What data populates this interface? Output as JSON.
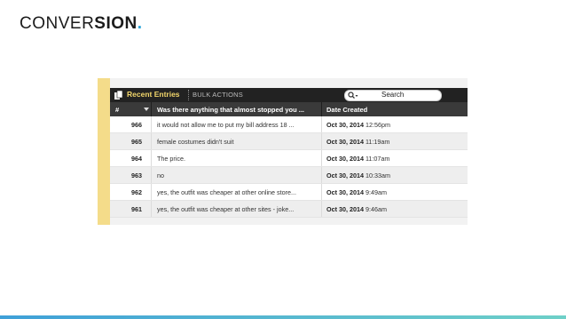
{
  "brand": {
    "part1": "CONVER",
    "part2": "SION",
    "dot": "."
  },
  "panel": {
    "title": "Recent Entries",
    "bulk_actions": "BULK ACTIONS",
    "search_label": "Search",
    "columns": {
      "num": "#",
      "question": "Was there anything that almost stopped you ...",
      "date": "Date Created"
    },
    "rows": [
      {
        "num": "966",
        "answer": "it would not allow me to put my bill address 18 ...",
        "date": "Oct 30, 2014",
        "time": "12:56pm"
      },
      {
        "num": "965",
        "answer": "female costumes didn't suit",
        "date": "Oct 30, 2014",
        "time": "11:19am"
      },
      {
        "num": "964",
        "answer": "The price.",
        "date": "Oct 30, 2014",
        "time": "11:07am"
      },
      {
        "num": "963",
        "answer": "no",
        "date": "Oct 30, 2014",
        "time": "10:33am"
      },
      {
        "num": "962",
        "answer": "yes, the outfit was cheaper at other online store...",
        "date": "Oct 30, 2014",
        "time": "9:49am"
      },
      {
        "num": "961",
        "answer": "yes, the outfit was cheaper at other sites - joke...",
        "date": "Oct 30, 2014",
        "time": "9:46am"
      }
    ]
  },
  "colors": {
    "accent": "#29a3d8",
    "title_yellow": "#f2d66b",
    "side_bar": "#f4dc8a"
  }
}
